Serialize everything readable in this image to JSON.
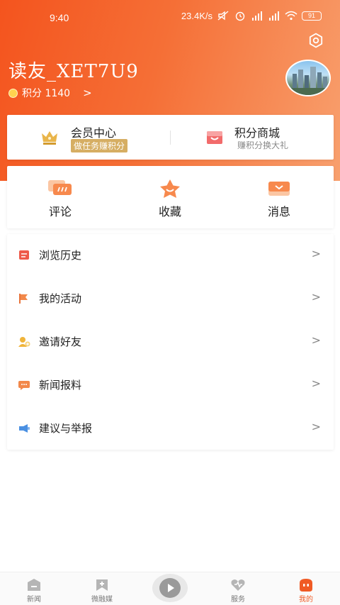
{
  "colors": {
    "accent": "#f05a24",
    "gold": "#d6ae63"
  },
  "status_bar": {
    "time": "9:40",
    "speed": "23.4K/s",
    "battery": "91"
  },
  "profile": {
    "username": "读友_XET7U9",
    "points_label": "积分 1140",
    "points_chevron": ">",
    "settings_icon": "gear-icon",
    "avatar": "city-skyline-avatar"
  },
  "membership": {
    "vip": {
      "title": "会员中心",
      "subtitle": "做任务赚积分",
      "icon": "crown-icon"
    },
    "shop": {
      "title": "积分商城",
      "subtitle": "赚积分换大礼",
      "icon": "shopping-bag-icon"
    }
  },
  "quick_actions": [
    {
      "label": "评论",
      "icon": "comment-icon"
    },
    {
      "label": "收藏",
      "icon": "star-icon"
    },
    {
      "label": "消息",
      "icon": "envelope-icon"
    }
  ],
  "menu": [
    {
      "label": "浏览历史",
      "icon": "history-icon",
      "chevron": ">"
    },
    {
      "label": "我的活动",
      "icon": "flag-icon",
      "chevron": ">"
    },
    {
      "label": "邀请好友",
      "icon": "invite-friend-icon",
      "chevron": ">"
    },
    {
      "label": "新闻报料",
      "icon": "news-tip-icon",
      "chevron": ">"
    },
    {
      "label": "建议与举报",
      "icon": "feedback-icon",
      "chevron": ">"
    }
  ],
  "bottom_nav": [
    {
      "label": "新闻",
      "icon": "news-icon"
    },
    {
      "label": "微融媒",
      "icon": "media-icon"
    },
    {
      "label": "",
      "icon": "play-icon"
    },
    {
      "label": "服务",
      "icon": "heart-icon"
    },
    {
      "label": "我的",
      "icon": "profile-icon",
      "active": true
    }
  ]
}
